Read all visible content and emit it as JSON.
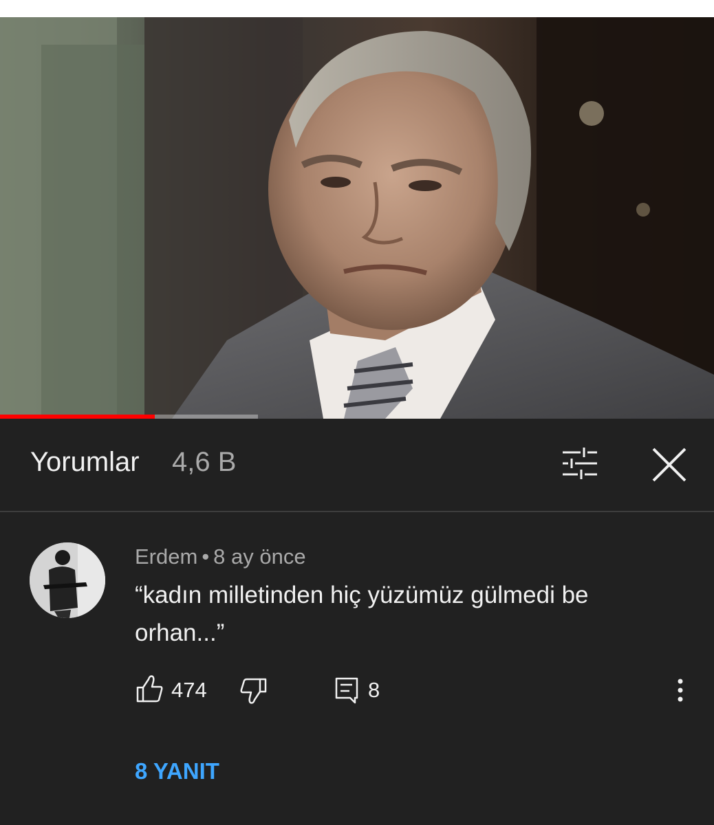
{
  "video": {
    "progress_fraction": 0.217,
    "progress_color": "#ff0000"
  },
  "comments_header": {
    "title": "Yorumlar",
    "count": "4,6 B",
    "filter_icon": "sliders-icon",
    "close_icon": "close-icon"
  },
  "comment": {
    "author": "Erdem",
    "separator": "•",
    "time": "8 ay önce",
    "text": "“kadın milletinden hiç yüzümüz gülmedi be orhan...”",
    "likes": "474",
    "reply_count": "8",
    "like_icon": "thumbs-up-icon",
    "dislike_icon": "thumbs-down-icon",
    "reply_icon": "reply-icon",
    "more_icon": "more-vertical-icon"
  },
  "replies_link": "8 YANIT",
  "colors": {
    "background": "#212121",
    "link": "#3ea6ff",
    "text_primary": "#f1f1f1",
    "text_secondary": "#aaaaaa"
  }
}
